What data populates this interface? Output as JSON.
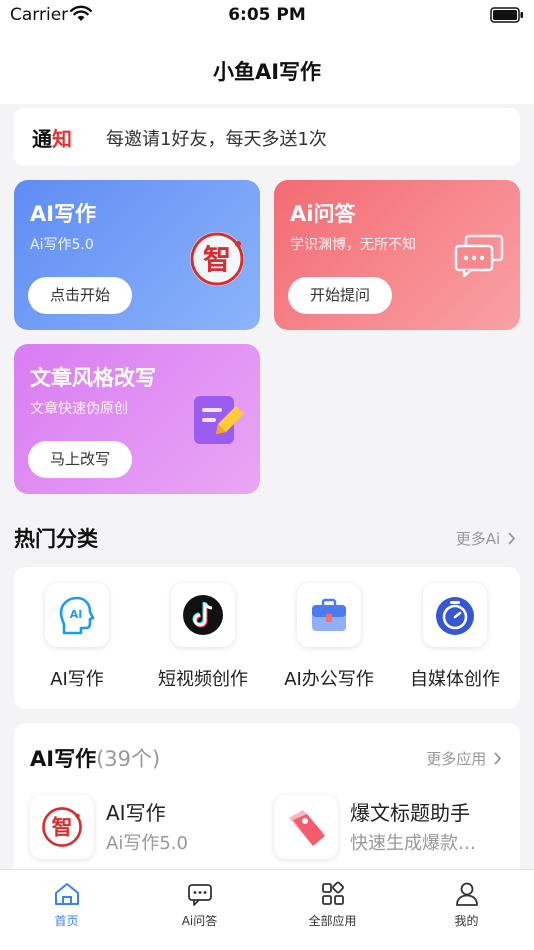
{
  "status": {
    "carrier": "Carrier",
    "time": "6:05 PM"
  },
  "nav": {
    "title": "小鱼AI写作"
  },
  "notice": {
    "tag_part1": "通",
    "tag_part2": "知",
    "text": "每邀请1好友，每天多送1次"
  },
  "cards": [
    {
      "title": "AI写作",
      "subtitle": "Ai写作5.0",
      "button": "点击开始",
      "icon": "zhi-seal-icon"
    },
    {
      "title": "Ai问答",
      "subtitle": "学识渊博，无所不知",
      "button": "开始提问",
      "icon": "chat-bubbles-icon"
    },
    {
      "title": "文章风格改写",
      "subtitle": "文章快速伪原创",
      "button": "马上改写",
      "icon": "edit-document-icon"
    }
  ],
  "hot": {
    "title": "热门分类",
    "more": "更多Ai",
    "items": [
      {
        "label": "AI写作",
        "icon": "ai-head-icon"
      },
      {
        "label": "短视频创作",
        "icon": "tiktok-icon"
      },
      {
        "label": "AI办公写作",
        "icon": "briefcase-icon"
      },
      {
        "label": "自媒体创作",
        "icon": "timer-icon"
      }
    ]
  },
  "apps": {
    "title": "AI写作",
    "count": "(39个)",
    "more": "更多应用",
    "items": [
      {
        "name": "AI写作",
        "desc": "Ai写作5.0",
        "icon": "zhi-seal-icon"
      },
      {
        "name": "爆文标题助手",
        "desc": "快速生成爆款…",
        "icon": "price-tag-icon"
      }
    ]
  },
  "tabs": [
    {
      "label": "首页",
      "icon": "home-icon",
      "active": true
    },
    {
      "label": "Ai问答",
      "icon": "chat-icon"
    },
    {
      "label": "全部应用",
      "icon": "grid-icon"
    },
    {
      "label": "我的",
      "icon": "user-icon"
    }
  ],
  "colors": {
    "accent": "#3b82f6",
    "notice_red": "#e23232",
    "seal_red": "#d92c2c"
  }
}
